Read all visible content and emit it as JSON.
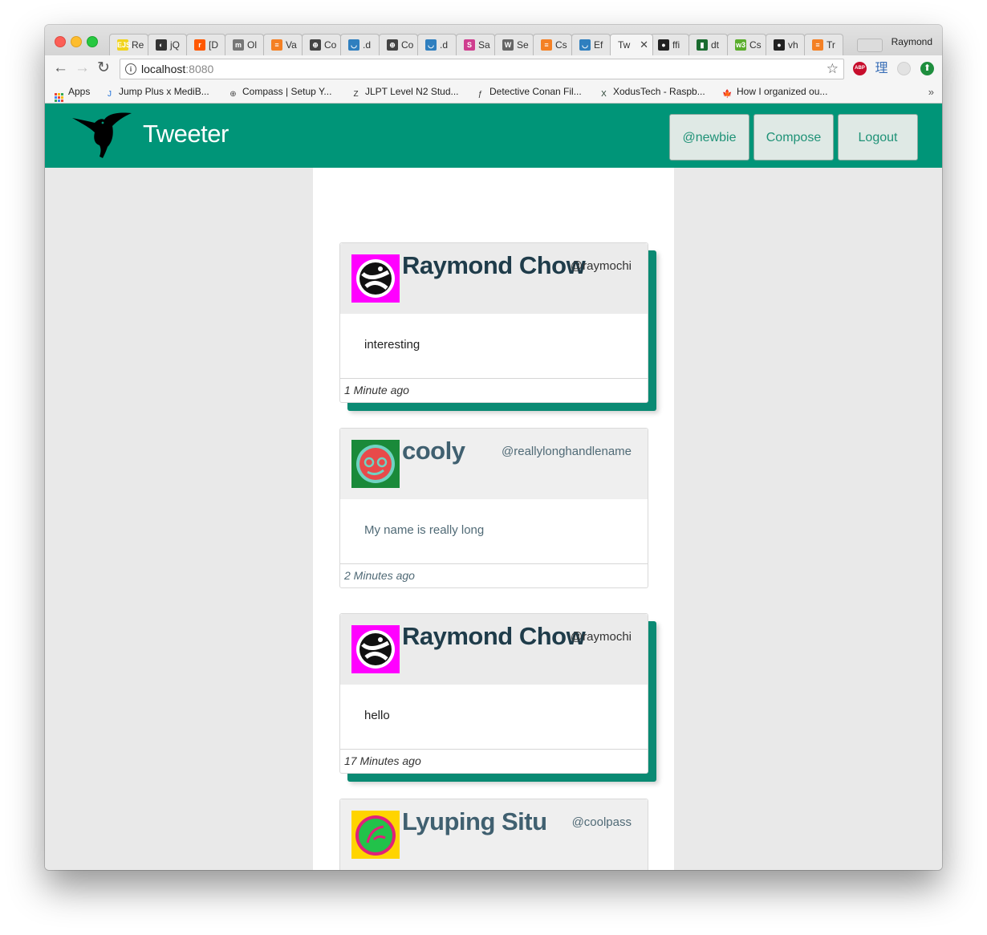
{
  "browser": {
    "tabs": [
      {
        "favicon_text": "EJS",
        "favicon_color": "#f1d41e",
        "title": "Re"
      },
      {
        "favicon_text": "◐",
        "favicon_color": "#333333",
        "title": "jQ"
      },
      {
        "favicon_text": "r",
        "favicon_color": "#ff5700",
        "title": "[D"
      },
      {
        "favicon_text": "m",
        "favicon_color": "#777777",
        "title": "Ol"
      },
      {
        "favicon_text": "≡",
        "favicon_color": "#f48024",
        "title": "Va"
      },
      {
        "favicon_text": "⊕",
        "favicon_color": "#444444",
        "title": "Co"
      },
      {
        "favicon_text": "◡",
        "favicon_color": "#2f7fbf",
        "title": ".d"
      },
      {
        "favicon_text": "⊕",
        "favicon_color": "#444444",
        "title": "Co"
      },
      {
        "favicon_text": "◡",
        "favicon_color": "#2f7fbf",
        "title": ".d"
      },
      {
        "favicon_text": "S",
        "favicon_color": "#cf3e8f",
        "title": "Sa"
      },
      {
        "favicon_text": "W",
        "favicon_color": "#666666",
        "title": "Se"
      },
      {
        "favicon_text": "≡",
        "favicon_color": "#f48024",
        "title": "Cs"
      },
      {
        "favicon_text": "◡",
        "favicon_color": "#2f7fbf",
        "title": "Ef"
      },
      {
        "favicon_text": "",
        "favicon_color": "#f5f5f5",
        "title": "Tw",
        "close": "✕"
      },
      {
        "favicon_text": "●",
        "favicon_color": "#222222",
        "title": "ffi"
      },
      {
        "favicon_text": "▮",
        "favicon_color": "#1a6b2f",
        "title": "dt"
      },
      {
        "favicon_text": "w3",
        "favicon_color": "#5aad2d",
        "title": "Cs"
      },
      {
        "favicon_text": "●",
        "favicon_color": "#222222",
        "title": "vh"
      },
      {
        "favicon_text": "≡",
        "favicon_color": "#f48024",
        "title": "Tr"
      }
    ],
    "profile_name": "Raymond",
    "url_host": "localhost",
    "url_port": ":8080",
    "nav": {
      "back": "←",
      "forward": "→",
      "reload": "↻"
    },
    "icons": {
      "info": "i",
      "star": "☆",
      "abp": "ABP",
      "li": "理",
      "green": "⬆",
      "more": "»"
    },
    "bookmarks": [
      {
        "label": "Apps",
        "icon": "apps-icon",
        "color": "#4285f4"
      },
      {
        "label": "Jump Plus x MediB...",
        "icon": "J",
        "color": "#1e6fd9"
      },
      {
        "label": "Compass | Setup Y...",
        "icon": "⊕",
        "color": "#444444"
      },
      {
        "label": "JLPT Level N2 Stud...",
        "icon": "Z",
        "color": "#333333"
      },
      {
        "label": "Detective Conan Fil...",
        "icon": "ƒ",
        "color": "#333333"
      },
      {
        "label": "XodusTech - Raspb...",
        "icon": "X",
        "color": "#1f3a2a"
      },
      {
        "label": "How I organized ou...",
        "icon": "🍁",
        "color": "#d0021b"
      }
    ]
  },
  "app": {
    "brand": "Tweeter",
    "accent": "#009578",
    "nav": {
      "handle_button": "@newbie",
      "compose_button": "Compose",
      "logout_button": "Logout"
    }
  },
  "tweets": [
    {
      "name": "Raymond Chow",
      "handle": "@raymochi",
      "text": "interesting",
      "time": "1 Minute ago",
      "avatar_bg": "#ff00ff",
      "avatar_fg": "#111111"
    },
    {
      "name": "cooly",
      "handle": "@reallylonghandlename",
      "text": "My name is really long",
      "time": "2 Minutes ago",
      "avatar_bg": "#1a8a3a",
      "avatar_fg": "#e84a4a"
    },
    {
      "name": "Raymond Chow",
      "handle": "@raymochi",
      "text": "hello",
      "time": "17 Minutes ago",
      "avatar_bg": "#ff00ff",
      "avatar_fg": "#111111"
    },
    {
      "name": "Lyuping Situ",
      "handle": "@coolpass",
      "text": "",
      "time": "",
      "avatar_bg": "#ffd400",
      "avatar_fg": "#e0207a"
    }
  ]
}
